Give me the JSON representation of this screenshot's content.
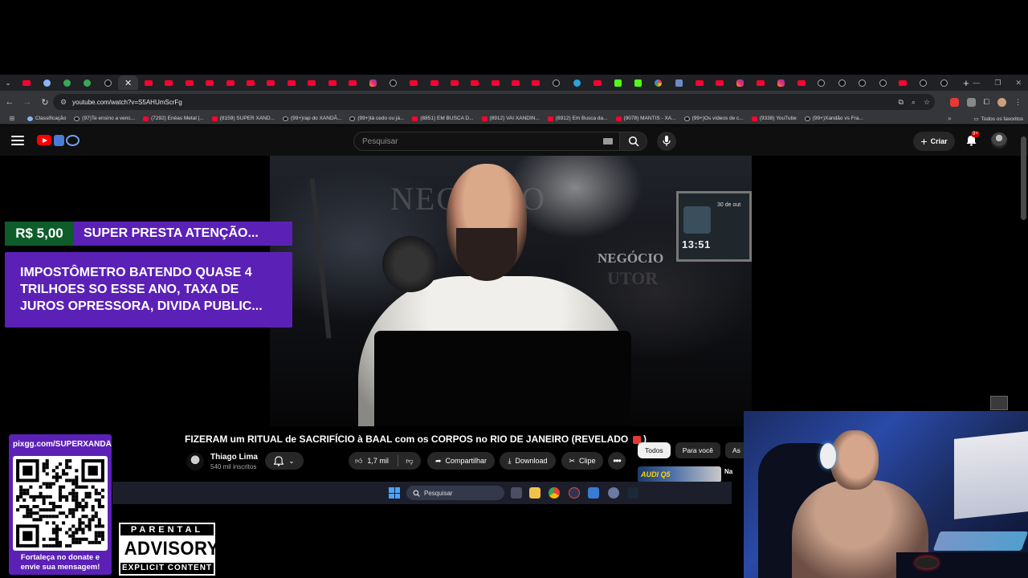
{
  "browser": {
    "tabs": [
      "yt",
      "chrome",
      "gr",
      "gr",
      "tt",
      "active",
      "yt",
      "yt",
      "yt",
      "yt",
      "yt",
      "yt",
      "yt",
      "yt",
      "yt",
      "yt",
      "yt",
      "ig",
      "tt",
      "yt",
      "yt",
      "yt",
      "yt",
      "yt",
      "yt",
      "yt",
      "tt",
      "tg",
      "yt",
      "kk",
      "kk",
      "gg",
      "ms",
      "yt",
      "yt",
      "ig",
      "yt",
      "ig",
      "yt",
      "tt",
      "tt",
      "tt",
      "tt",
      "yt",
      "tt",
      "tt"
    ],
    "close_glyph": "✕",
    "new_tab_glyph": "+",
    "url": "youtube.com/watch?v=S5AHUmScrFg",
    "bookmarks": [
      {
        "label": "Classificação",
        "icon": "sv"
      },
      {
        "label": "(97)Te ensino a venc...",
        "icon": "tt"
      },
      {
        "label": "(7292) Enéas Metal |...",
        "icon": "yt"
      },
      {
        "label": "(8159) SUPER XAND...",
        "icon": "yt"
      },
      {
        "label": "(99+)rap do XANDÃ...",
        "icon": "tt"
      },
      {
        "label": "(99+)tá cedo ou já...",
        "icon": "tt"
      },
      {
        "label": "(8851) EM BUSCA D...",
        "icon": "yt"
      },
      {
        "label": "(8912) VAI XANDIN...",
        "icon": "yt"
      },
      {
        "label": "(8912) Em Busca da...",
        "icon": "yt"
      },
      {
        "label": "(9078) MANTIS - XA...",
        "icon": "yt"
      },
      {
        "label": "(99+)Os vídeos de c...",
        "icon": "tt"
      },
      {
        "label": "(9338) YouTube",
        "icon": "yt"
      },
      {
        "label": "(99+)Xandão vs Fra...",
        "icon": "tt"
      }
    ],
    "bookmarks_more": "»",
    "all_bookmarks": "Todos os favoritos"
  },
  "youtube": {
    "search_placeholder": "Pesquisar",
    "create_label": "Criar",
    "notification_badge": "9+",
    "video": {
      "monitor_date": "30 de out",
      "monitor_time": "13:51",
      "sign_top": "NEGÓCIO",
      "sign_right": "NEGÓCIO",
      "sign_right2": "UTOR"
    },
    "title": "FIZERAM um RITUAL de SACRIFÍCIO à BAAL com os CORPOS no RIO DE JANEIRO (REVELADO",
    "title_end": ")",
    "channel_name": "Thiago Lima",
    "channel_subs": "540 mil inscritos",
    "likes": "1,7 mil",
    "share_label": "Compartilhar",
    "download_label": "Download",
    "clip_label": "Clipe",
    "more_label": "•••",
    "chips": [
      "Todos",
      "Para você",
      "As"
    ],
    "rec_thumb_text": "AUDI Q5",
    "rec_title": "Na"
  },
  "overlay": {
    "superchat_amount": "R$ 5,00",
    "superchat_name": "SUPER PRESTA ATENÇÃO...",
    "superchat_message": "IMPOSTÔMETRO BATENDO QUASE 4 TRILHOES SO ESSE ANO, TAXA DE JUROS OPRESSORA, DIVIDA PUBLIC...",
    "qr_url": "pixgg.com/SUPERXANDÃ",
    "qr_caption_1": "Fortaleça no donate e",
    "qr_caption_2": "envie sua mensagem!",
    "advisory_top": "PARENTAL",
    "advisory_mid": "ADVISORY",
    "advisory_bot": "EXPLICIT CONTENT"
  },
  "taskbar": {
    "search_label": "Pesquisar"
  },
  "colors": {
    "superchat_purple": "#5b21b6",
    "superchat_green": "#0d5c2a",
    "youtube_red": "#ff0000"
  }
}
